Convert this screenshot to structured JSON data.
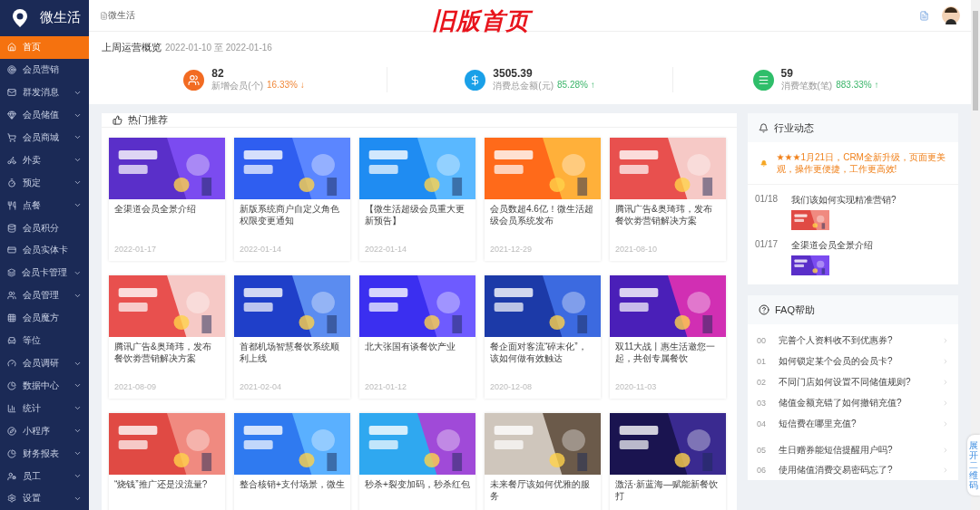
{
  "sidebar": {
    "brand": "微生活",
    "items": [
      {
        "label": "首页",
        "selected": true,
        "has_submenu": false
      },
      {
        "label": "会员营销",
        "selected": false,
        "has_submenu": false
      },
      {
        "label": "群发消息",
        "selected": false,
        "has_submenu": true
      },
      {
        "label": "会员储值",
        "selected": false,
        "has_submenu": true
      },
      {
        "label": "会员商城",
        "selected": false,
        "has_submenu": true
      },
      {
        "label": "外卖",
        "selected": false,
        "has_submenu": true
      },
      {
        "label": "预定",
        "selected": false,
        "has_submenu": true
      },
      {
        "label": "点餐",
        "selected": false,
        "has_submenu": true
      },
      {
        "label": "会员积分",
        "selected": false,
        "has_submenu": false
      },
      {
        "label": "会员实体卡",
        "selected": false,
        "has_submenu": false
      },
      {
        "label": "会员卡管理",
        "selected": false,
        "has_submenu": true
      },
      {
        "label": "会员管理",
        "selected": false,
        "has_submenu": true
      },
      {
        "label": "会员魔方",
        "selected": false,
        "has_submenu": false
      },
      {
        "label": "等位",
        "selected": false,
        "has_submenu": false
      },
      {
        "label": "会员调研",
        "selected": false,
        "has_submenu": true
      },
      {
        "label": "数据中心",
        "selected": false,
        "has_submenu": true
      },
      {
        "label": "统计",
        "selected": false,
        "has_submenu": true
      },
      {
        "label": "小程序",
        "selected": false,
        "has_submenu": true
      },
      {
        "label": "财务报表",
        "selected": false,
        "has_submenu": true
      },
      {
        "label": "员工",
        "selected": false,
        "has_submenu": true
      },
      {
        "label": "设置",
        "selected": false,
        "has_submenu": true
      }
    ]
  },
  "header": {
    "breadcrumb": "微生活",
    "banner": "旧版首页"
  },
  "overview": {
    "title": "上周运营概览",
    "range": "2022-01-10 至 2022-01-16",
    "stats": [
      {
        "value": "82",
        "label": "新增会员(个)",
        "change": "16.33%",
        "arrow": "↓",
        "up": false,
        "color": "#f26b22"
      },
      {
        "value": "3505.39",
        "label": "消费总金额(元)",
        "change": "85.28%",
        "arrow": "↑",
        "up": true,
        "color": "#1aa0e8"
      },
      {
        "value": "59",
        "label": "消费笔数(笔)",
        "change": "883.33%",
        "arrow": "↑",
        "up": true,
        "color": "#2fbe6a"
      }
    ]
  },
  "hot": {
    "title": "热门推荐",
    "articles": [
      {
        "title": "全渠道会员全景介绍",
        "date": "2022-01-17"
      },
      {
        "title": "新版系统商户自定义角色权限变更通知",
        "date": "2022-01-14"
      },
      {
        "title": "【微生活超级会员重大更新预告】",
        "date": "2022-01-14"
      },
      {
        "title": "会员数超4.6亿！微生活超级会员系统发布",
        "date": "2021-12-29"
      },
      {
        "title": "腾讯广告&奥琦玮，发布餐饮劵营销解决方案",
        "date": "2021-08-10"
      },
      {
        "title": "腾讯广告&奥琦玮，发布餐饮劵营销解决方案",
        "date": "2021-08-09"
      },
      {
        "title": "首都机场智慧餐饮系统顺利上线",
        "date": "2021-02-04"
      },
      {
        "title": "北大张国有谈餐饮产业",
        "date": "2021-01-12"
      },
      {
        "title": "餐企面对客流“碎末化”，该如何做有效触达",
        "date": "2020-12-08"
      },
      {
        "title": "双11大战丨惠生活邀您一起，共创专属餐饮",
        "date": "2020-11-03"
      },
      {
        "title": "“烧钱”推广还是没流量?"
      },
      {
        "title": "整合核销+支付场景，微生"
      },
      {
        "title": "秒杀+裂变加码，秒杀红包"
      },
      {
        "title": "未来餐厅该如何优雅的服务"
      },
      {
        "title": "激活·新蓝海—赋能新餐饮打"
      }
    ]
  },
  "news": {
    "title": "行业动态",
    "notice": "★★★1月21日，CRM全新升级，页面更美观，操作更便捷，工作更高效!",
    "items": [
      {
        "date": "01/18",
        "title": "我们该如何实现精准营销?"
      },
      {
        "date": "01/17",
        "title": "全渠道会员全景介绍"
      }
    ]
  },
  "faq": {
    "title": "FAQ帮助",
    "items": [
      {
        "index": "00",
        "question": "完善个人资料收不到优惠券?"
      },
      {
        "index": "01",
        "question": "如何锁定某个会员的会员卡?"
      },
      {
        "index": "02",
        "question": "不同门店如何设置不同储值规则?"
      },
      {
        "index": "03",
        "question": "储值金额充错了如何撤销充值?"
      },
      {
        "index": "04",
        "question": "短信费在哪里充值?"
      },
      {
        "index": "05",
        "question": "生日赠券能短信提醒用户吗?"
      },
      {
        "index": "06",
        "question": "使用储值消费交易密码忘了?"
      }
    ]
  },
  "side_tab": {
    "label": "展开二维码"
  }
}
